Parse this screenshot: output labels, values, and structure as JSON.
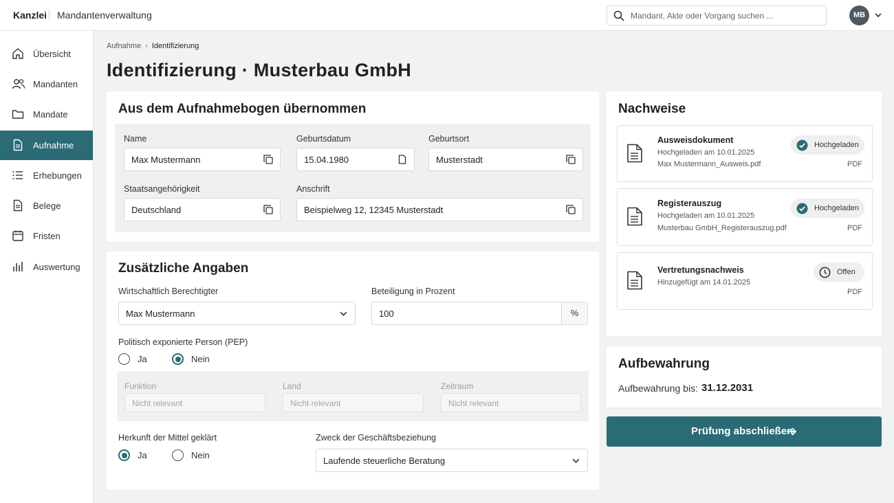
{
  "topbar": {
    "brand": "Kanzlei",
    "app_title": "Mandantenverwaltung",
    "search_placeholder": "Mandant, Akte oder Vorgang suchen ...",
    "avatar_initials": "MB"
  },
  "sidebar": {
    "items": [
      {
        "label": "Übersicht",
        "icon": "home-icon"
      },
      {
        "label": "Mandanten",
        "icon": "users-icon"
      },
      {
        "label": "Mandate",
        "icon": "folder-icon"
      },
      {
        "label": "Aufnahme",
        "icon": "document-icon",
        "active": true
      },
      {
        "label": "Erhebungen",
        "icon": "list-icon"
      },
      {
        "label": "Belege",
        "icon": "receipt-icon"
      },
      {
        "label": "Fristen",
        "icon": "calendar-icon"
      },
      {
        "label": "Auswertung",
        "icon": "bar-chart-icon"
      }
    ]
  },
  "breadcrumb": {
    "parent": "Aufnahme",
    "current": "Identifizierung"
  },
  "page_title": "Identifizierung · Musterbau GmbH",
  "intake": {
    "title": "Aus dem Aufnahmebogen übernommen",
    "name_label": "Name",
    "name_value": "Max Mustermann",
    "birthdate_label": "Geburtsdatum",
    "birthdate_value": "15.04.1980",
    "birthplace_label": "Geburtsort",
    "birthplace_value": "Musterstadt",
    "nationality_label": "Staatsangehörigkeit",
    "nationality_value": "Deutschland",
    "address_label": "Anschrift",
    "address_value": "Beispielweg 12, 12345 Musterstadt"
  },
  "additional": {
    "title": "Zusätzliche Angaben",
    "beneficial_owner_label": "Wirtschaftlich Berechtigter",
    "beneficial_owner_value": "Max Mustermann",
    "share_label": "Beteiligung in Prozent",
    "share_value": "100",
    "share_unit": "%",
    "pep_label": "Politisch exponierte Person (PEP)",
    "pep_yes": "Ja",
    "pep_no": "Nein",
    "pep_selected": "Nein",
    "pep_function_label": "Funktion",
    "pep_country_label": "Land",
    "pep_period_label": "Zeitraum",
    "not_relevant": "Nicht relevant",
    "funds_label": "Herkunft der Mittel geklärt",
    "funds_yes": "Ja",
    "funds_no": "Nein",
    "funds_selected": "Ja",
    "purpose_label": "Zweck der Geschäftsbeziehung",
    "purpose_value": "Laufende steuerliche Beratung"
  },
  "evidence": {
    "title": "Nachweise",
    "documents": [
      {
        "title": "Ausweisdokument",
        "meta1": "Hochgeladen am 10.01.2025",
        "meta2": "Max Mustermann_Ausweis.pdf",
        "status": "Hochgeladen",
        "status_icon": "check-circle-icon",
        "type": "PDF"
      },
      {
        "title": "Registerauszug",
        "meta1": "Hochgeladen am 10.01.2025",
        "meta2": "Musterbau GmbH_Registerauszug.pdf",
        "status": "Hochgeladen",
        "status_icon": "check-circle-icon",
        "type": "PDF"
      },
      {
        "title": "Vertretungsnachweis",
        "meta1": "Hinzugefügt am 14.01.2025",
        "status": "Offen",
        "status_icon": "clock-icon",
        "type": "PDF"
      }
    ]
  },
  "retention": {
    "title": "Aufbewahrung",
    "label": "Aufbewahrung bis:",
    "value": "31.12.2031"
  },
  "cta_label": "Prüfung abschließen",
  "colors": {
    "accent": "#2a6b75",
    "success": "#2a6b75",
    "background": "#f1f2f2"
  }
}
